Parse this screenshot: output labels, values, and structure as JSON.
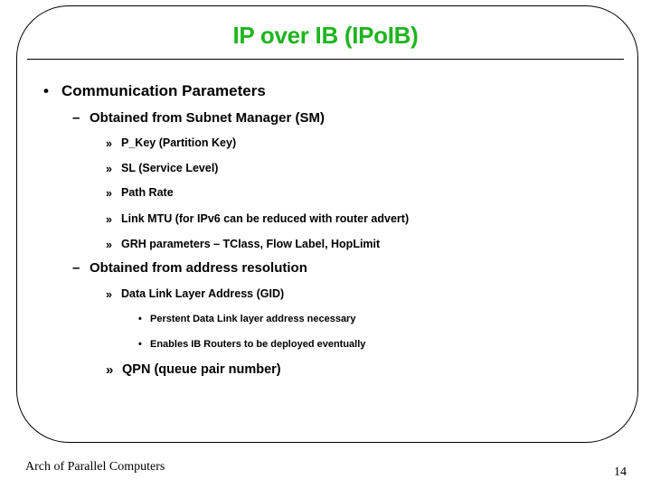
{
  "slide": {
    "title": "IP over IB (IPoIB)",
    "bullets": {
      "level1_marker": "•",
      "level2_marker": "–",
      "level3_marker": "»",
      "level4_marker": "•",
      "communication_parameters": "Communication Parameters",
      "from_sm": "Obtained from Subnet Manager (SM)",
      "sm_items": [
        "P_Key (Partition Key)",
        "SL (Service Level)",
        "Path Rate",
        "Link MTU (for IPv6 can be reduced with router advert)",
        "GRH parameters – TClass, Flow Label, HopLimit"
      ],
      "from_address_resolution": "Obtained from address resolution",
      "dll_address": "Data Link Layer Address (GID)",
      "dll_subitems": [
        "Perstent Data Link layer address necessary",
        "Enables IB Routers to be deployed eventually"
      ],
      "qpn": "QPN (queue pair number)"
    },
    "footer": "Arch of Parallel Computers",
    "page_number": "14",
    "colors": {
      "title": "#1fb51f",
      "text": "#000000"
    }
  }
}
